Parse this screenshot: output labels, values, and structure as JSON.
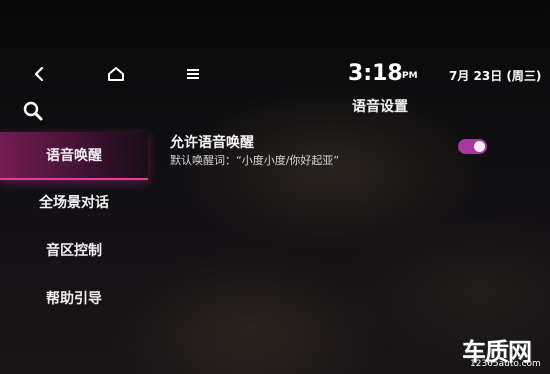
{
  "status": {
    "time": "3:18",
    "ampm": "PM",
    "date": "7月 23日 (周三)"
  },
  "page": {
    "title": "语音设置"
  },
  "icons": {
    "back": "chevron-left-icon",
    "home": "home-icon",
    "menu": "menu-icon",
    "search": "search-icon"
  },
  "sidebar": {
    "items": [
      {
        "label": "语音唤醒",
        "active": true
      },
      {
        "label": "全场景对话",
        "active": false
      },
      {
        "label": "音区控制",
        "active": false
      },
      {
        "label": "帮助引导",
        "active": false
      }
    ]
  },
  "setting": {
    "title": "允许语音唤醒",
    "subtitle": "默认唤醒词：“小度小度/你好起亚”",
    "enabled": true
  },
  "colors": {
    "accent": "#a63a9a",
    "active_bar": "#e23ca0",
    "background": "#0d0c0e"
  },
  "watermark": {
    "name": "车质网",
    "url": "12365auto.com"
  }
}
